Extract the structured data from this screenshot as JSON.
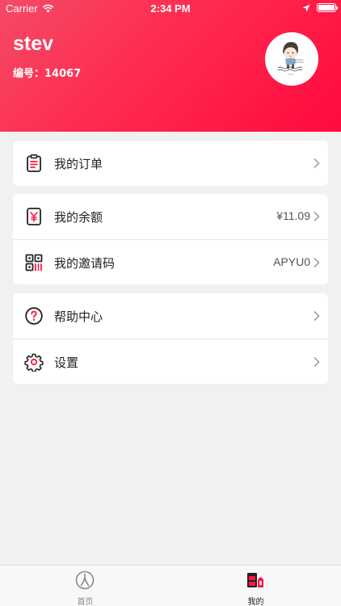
{
  "status_bar": {
    "carrier": "Carrier",
    "time": "2:34 PM",
    "battery_level": 1.0
  },
  "profile": {
    "username": "stev",
    "id_label": "编号：14067",
    "avatar": "avatar-cartoon-icon"
  },
  "menu_groups": [
    [
      {
        "label": "我的订单",
        "icon": "order-clipboard-icon",
        "value": ""
      }
    ],
    [
      {
        "label": "我的余额",
        "icon": "balance-yen-icon",
        "value": "¥11.09"
      },
      {
        "label": "我的邀请码",
        "icon": "qr-code-icon",
        "value": "APYU0"
      }
    ],
    [
      {
        "label": "帮助中心",
        "icon": "help-question-icon",
        "value": ""
      },
      {
        "label": "设置",
        "icon": "settings-gear-icon",
        "value": ""
      }
    ]
  ],
  "tabbar": {
    "tabs": [
      {
        "label": "首页",
        "icon": "home-icon",
        "active": false
      },
      {
        "label": "我的",
        "icon": "profile-shop-icon",
        "active": true
      }
    ]
  },
  "colors": {
    "brand": "#ff1744",
    "header_gradient_start": "#f44a66",
    "header_gradient_end": "#ff0a3e",
    "tab_active": "#222222",
    "tab_inactive": "#8a8a8a"
  }
}
